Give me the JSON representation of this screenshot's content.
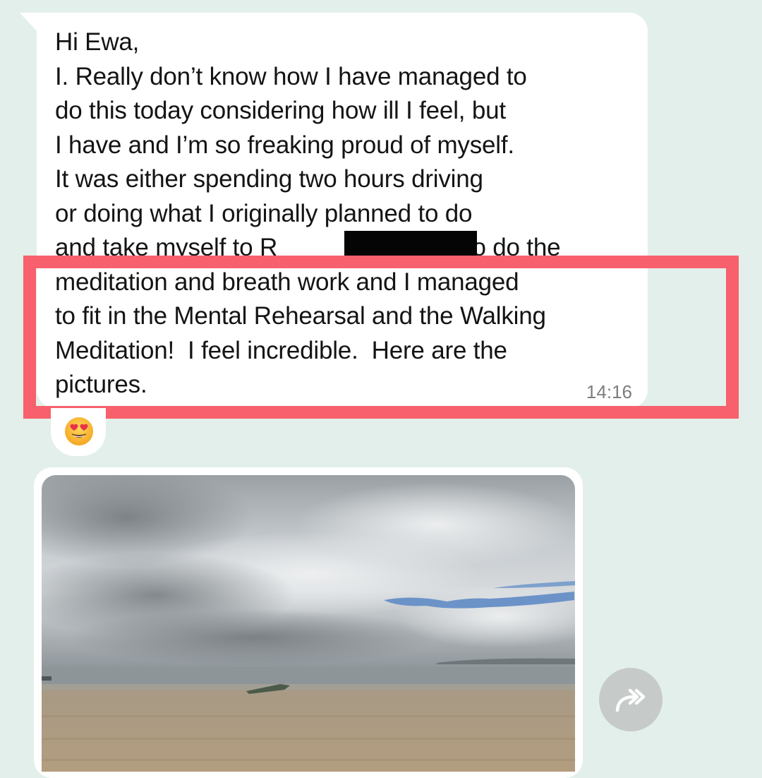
{
  "message": {
    "lines": [
      "Hi Ewa,",
      "I. Really don’t know how I have managed to",
      "do this today considering how ill I feel, but",
      "I have and I’m so freaking proud of myself.",
      "It was either spending two hours driving",
      "or doing what I originally planned to do",
      "and take myself to R                         a to do the",
      "meditation and breath work and I managed",
      "to fit in the Mental Rehearsal and the Walking",
      "Meditation!  I feel incredible.  Here are the",
      "pictures."
    ],
    "time": "14:16",
    "reaction_icon": "heart-eyes-emoji"
  },
  "highlight": {
    "color": "#f7606c"
  },
  "photo": {
    "icon": "beach-photo"
  },
  "forward": {
    "icon": "forward-arrow-icon"
  },
  "colors": {
    "background": "#e3efea",
    "bubble": "#ffffff",
    "text": "#141414",
    "timestamp": "#7b7f7d",
    "redaction": "#050505"
  }
}
